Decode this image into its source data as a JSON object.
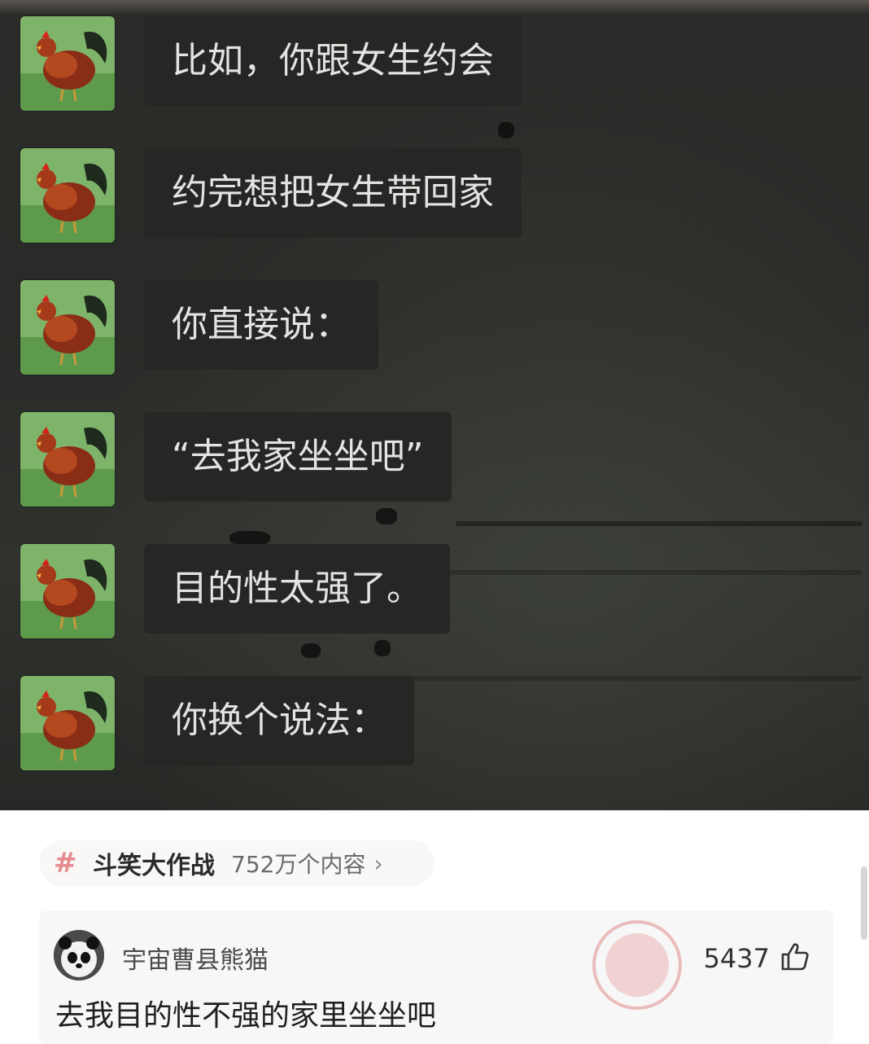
{
  "chat": {
    "messages": [
      {
        "text": "比如，你跟女生约会"
      },
      {
        "text": "约完想把女生带回家"
      },
      {
        "text": "你直接说："
      },
      {
        "text": "“去我家坐坐吧”"
      },
      {
        "text": "目的性太强了。"
      },
      {
        "text": "你换个说法："
      }
    ]
  },
  "topic": {
    "hash": "#",
    "name": "斗笑大作战",
    "count": "752万个内容",
    "chevron": "›"
  },
  "comment": {
    "username": "宇宙曹县熊猫",
    "text": "去我目的性不强的家里坐坐吧",
    "likes": "5437",
    "avatar_icon": "panda-icon",
    "like_icon": "thumbs-up-icon",
    "stamp_icon": "god-comment-stamp-icon"
  },
  "colors": {
    "chat_bg": "#2b2c29",
    "bubble_bg": "#262725",
    "bubble_text": "#e3e3e1",
    "topic_hash": "#e58a8f"
  }
}
